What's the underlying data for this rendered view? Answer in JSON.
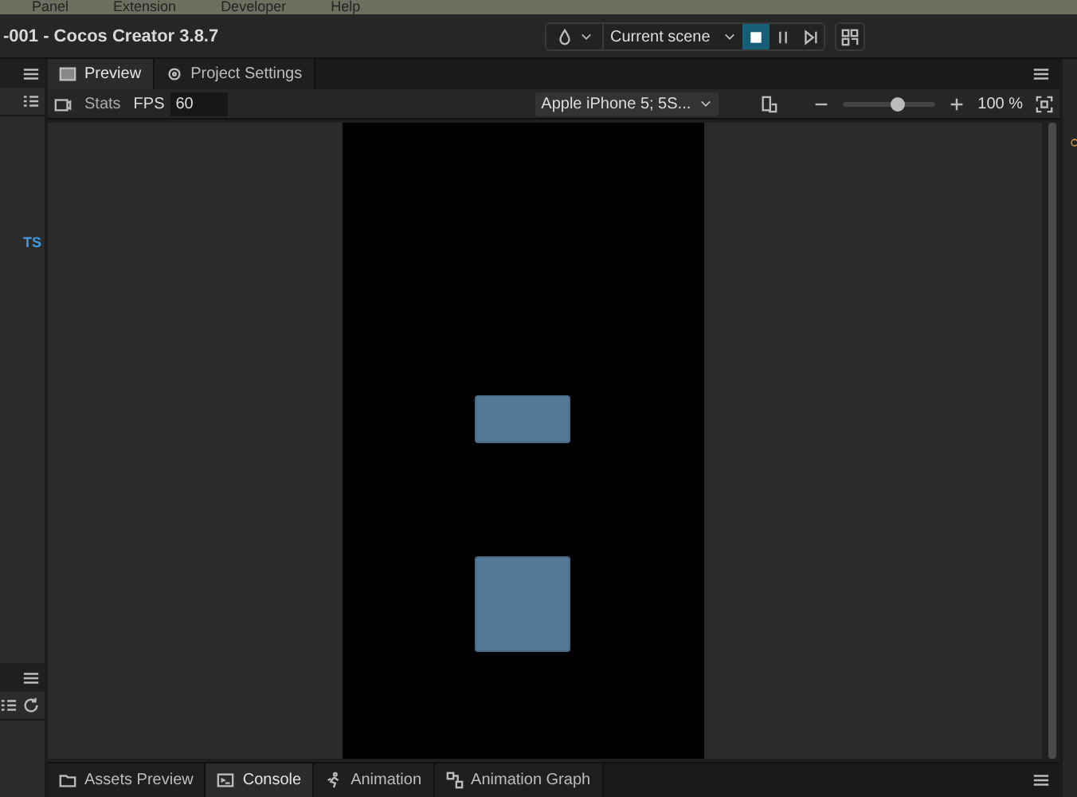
{
  "menu_bar": {
    "items": [
      "Panel",
      "Extension",
      "Developer",
      "Help"
    ]
  },
  "title_bar": {
    "title": "-001 - Cocos Creator 3.8.7",
    "scene_select": "Current scene",
    "controls": [
      {
        "kind": "stop",
        "selected": true
      },
      {
        "kind": "pause",
        "selected": false
      },
      {
        "kind": "step",
        "selected": false
      }
    ]
  },
  "left_panel": {
    "file_badge": "TS"
  },
  "preview_panel": {
    "tabs": [
      {
        "label": "Preview",
        "selected": true
      },
      {
        "label": "Project Settings",
        "selected": false
      }
    ],
    "toolbar": {
      "stats": "Stats",
      "fps_label": "FPS",
      "fps_value": "60",
      "device": "Apple iPhone 5; 5S...",
      "zoom": {
        "level": 0.6
      },
      "zoom_reading": "100 %"
    }
  },
  "bottom_tabs": [
    {
      "label": "Assets Preview",
      "kind": "assets",
      "selected": false
    },
    {
      "label": "Console",
      "kind": "console",
      "selected": true
    },
    {
      "label": "Animation",
      "kind": "animation",
      "selected": false
    },
    {
      "label": "Animation Graph",
      "kind": "graph",
      "selected": false
    }
  ]
}
